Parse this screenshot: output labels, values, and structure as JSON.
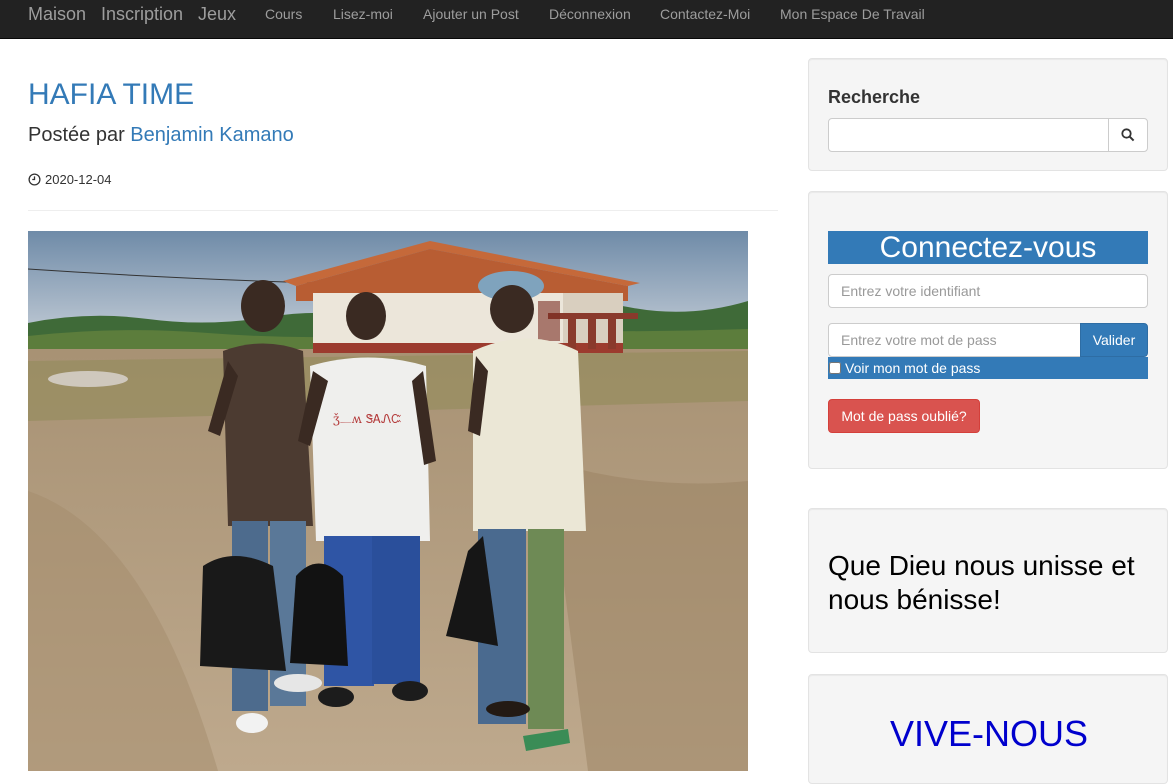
{
  "navbar": {
    "brands": [
      {
        "label": "Maison"
      },
      {
        "label": "Inscription"
      },
      {
        "label": "Jeux"
      }
    ],
    "links": [
      {
        "label": "Cours"
      },
      {
        "label": "Lisez-moi"
      },
      {
        "label": "Ajouter un Post"
      },
      {
        "label": "Déconnexion"
      },
      {
        "label": "Contactez-Moi"
      },
      {
        "label": "Mon Espace De Travail"
      }
    ]
  },
  "post": {
    "title": "HAFIA TIME",
    "byline_prefix": "Postée par",
    "author": "Benjamin Kamano",
    "date": "2020-12-04",
    "date_icon": "clock-icon",
    "photo": "three young men standing outdoors in front of a building, holding bags"
  },
  "sidebar": {
    "search": {
      "heading": "Recherche",
      "placeholder": "",
      "button_icon": "search-icon"
    },
    "login": {
      "heading": "Connectez-vous",
      "username_placeholder": "Entrez votre identifiant",
      "password_placeholder": "Entrez votre mot de pass",
      "submit_label": "Valider",
      "show_password_label": "Voir mon mot de pass",
      "forgot_label": "Mot de pass oublié?"
    },
    "quote": {
      "text": "Que Dieu nous unisse et nous bénisse!"
    },
    "vive": {
      "text": "VIVE-NOUS"
    }
  },
  "colors": {
    "navbar_bg": "#222222",
    "link_blue": "#337ab7",
    "danger": "#d9534f",
    "vive_blue": "#0000cd"
  }
}
